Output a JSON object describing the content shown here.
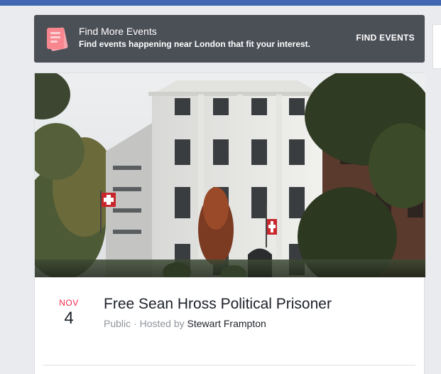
{
  "banner": {
    "title": "Find More Events",
    "subtitle": "Find events happening near London that fit your interest.",
    "cta": "FIND EVENTS",
    "icon": "ticket-icon",
    "bg_color": "#4b4f56",
    "icon_color": "#f7868e"
  },
  "event": {
    "month": "NOV",
    "day": "4",
    "title": "Free Sean Hross Political Prisoner",
    "privacy": "Public",
    "separator": " · ",
    "hosted_by_label": "Hosted by ",
    "host": "Stewart Frampton",
    "month_color": "#f02849"
  }
}
